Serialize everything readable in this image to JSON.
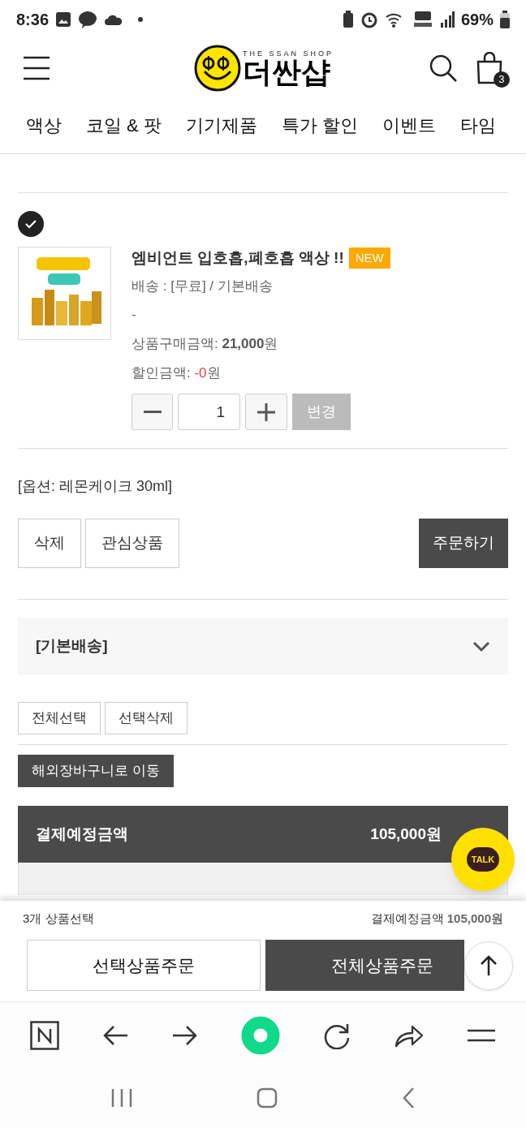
{
  "status_bar": {
    "time": "8:36",
    "battery": "69%"
  },
  "header": {
    "logo_tagline": "THE SSAN SHOP",
    "logo_text": "더싼샵",
    "cart_count": "3"
  },
  "nav": [
    {
      "label": "액상"
    },
    {
      "label": "코일 & 팟"
    },
    {
      "label": "기기제품"
    },
    {
      "label": "특가 할인"
    },
    {
      "label": "이벤트"
    },
    {
      "label": "타임"
    }
  ],
  "cart_item": {
    "checked": true,
    "title": "엠비언트 입호흡,폐호흡 액상 !!",
    "badge": "NEW",
    "shipping": "배송 : [무료] / 기본배송",
    "dash": "-",
    "price_label": "상품구매금액: ",
    "price": "21,000",
    "price_unit": "원",
    "discount_label": "할인금액: ",
    "discount": "-0",
    "discount_unit": "원",
    "quantity": "1",
    "change_button": "변경",
    "option": "[옵션: 레몬케이크 30ml]",
    "buttons": [
      "삭제",
      "관심상품"
    ],
    "order_button": "주문하기"
  },
  "shipping_group": {
    "title": "[기본배송]",
    "expanded": false
  },
  "list_buttons": [
    "전체선택",
    "선택삭제"
  ],
  "overseas_button": "해외장바구니로 이동",
  "summary": {
    "title": "결제예정금액",
    "amount": "105,000원"
  },
  "bottom_bar": {
    "count": "3개 상품선택",
    "total_label": "결제예정금액",
    "total": "105,000원",
    "buttons": [
      {
        "label": "선택상품주문",
        "kind": "outline"
      },
      {
        "label": "전체상품주문",
        "kind": "filled"
      }
    ]
  },
  "chat_button": "TALK"
}
